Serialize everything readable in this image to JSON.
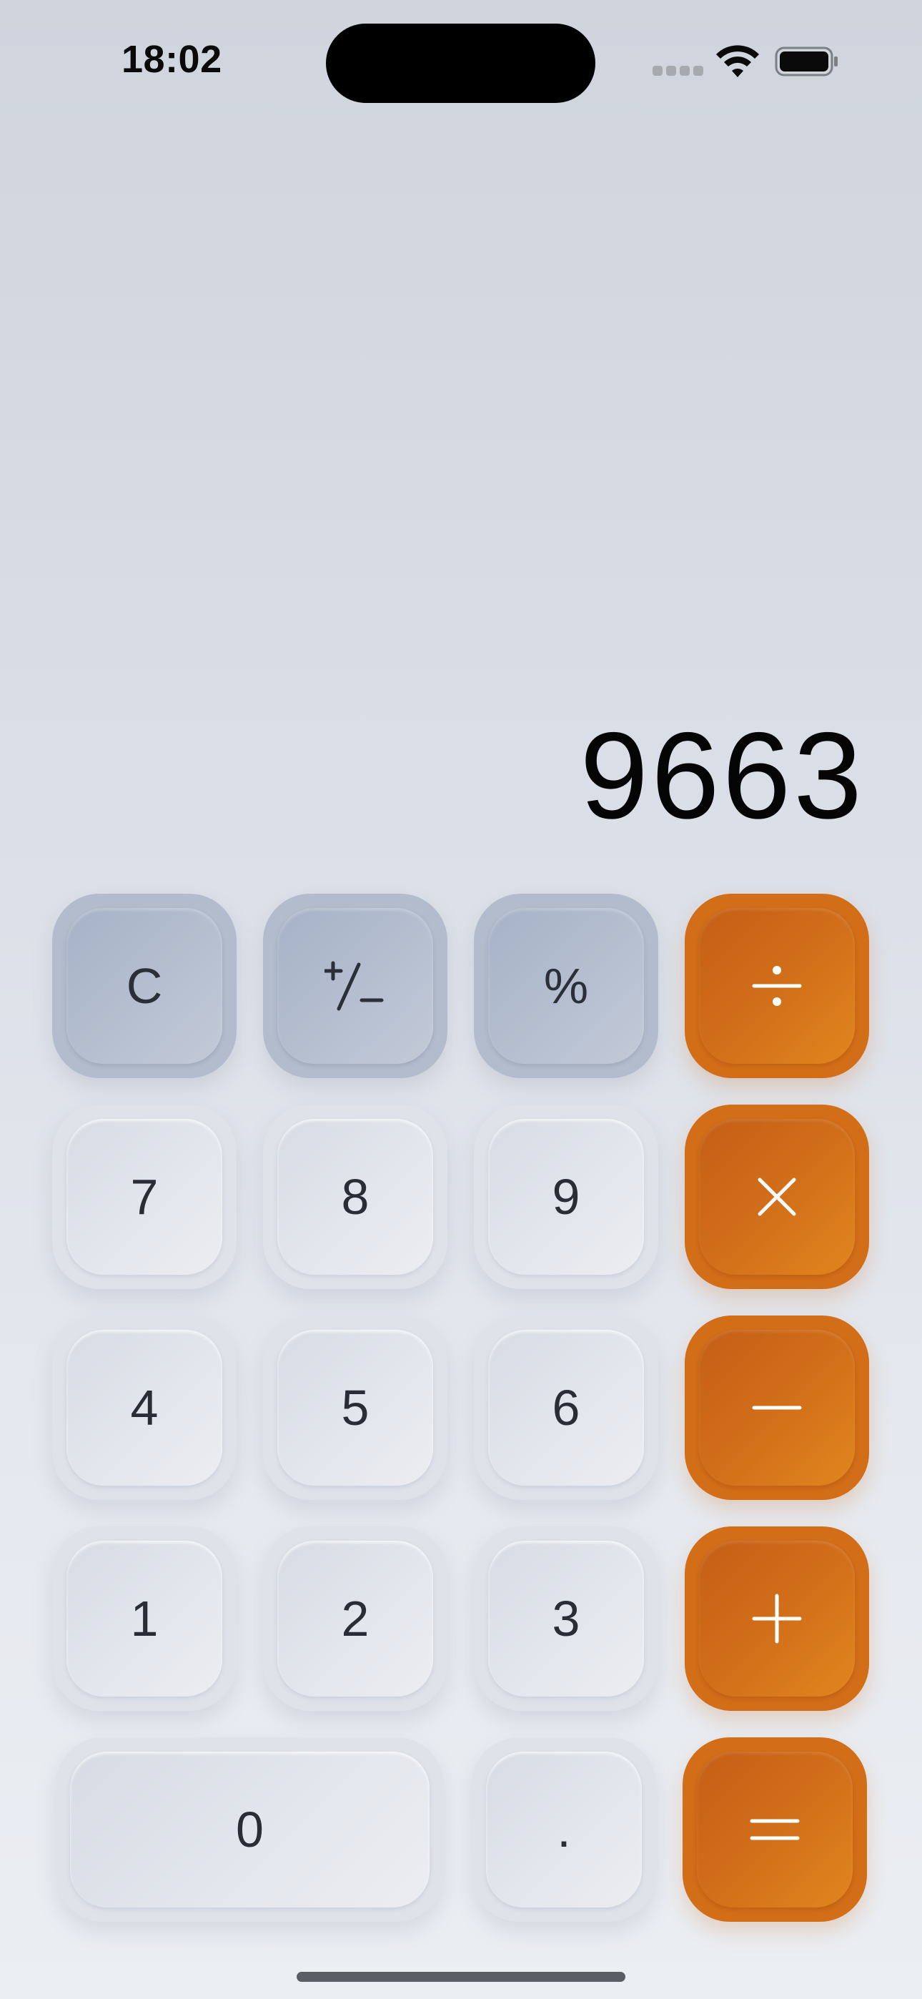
{
  "status_bar": {
    "time": "18:02",
    "icons": [
      "signal-icon",
      "wifi-icon",
      "battery-icon"
    ]
  },
  "display": {
    "value": "9663"
  },
  "keypad": {
    "clear": "C",
    "plus_minus": "+/−",
    "percent": "%",
    "divide": "÷",
    "seven": "7",
    "eight": "8",
    "nine": "9",
    "multiply": "×",
    "four": "4",
    "five": "5",
    "six": "6",
    "subtract": "−",
    "one": "1",
    "two": "2",
    "three": "3",
    "add": "+",
    "zero": "0",
    "decimal": ".",
    "equals": "="
  },
  "colors": {
    "operator": "#d26d18",
    "function": "#b2bccd",
    "number": "#dfe2e9",
    "text_dark": "#2a2d35"
  }
}
